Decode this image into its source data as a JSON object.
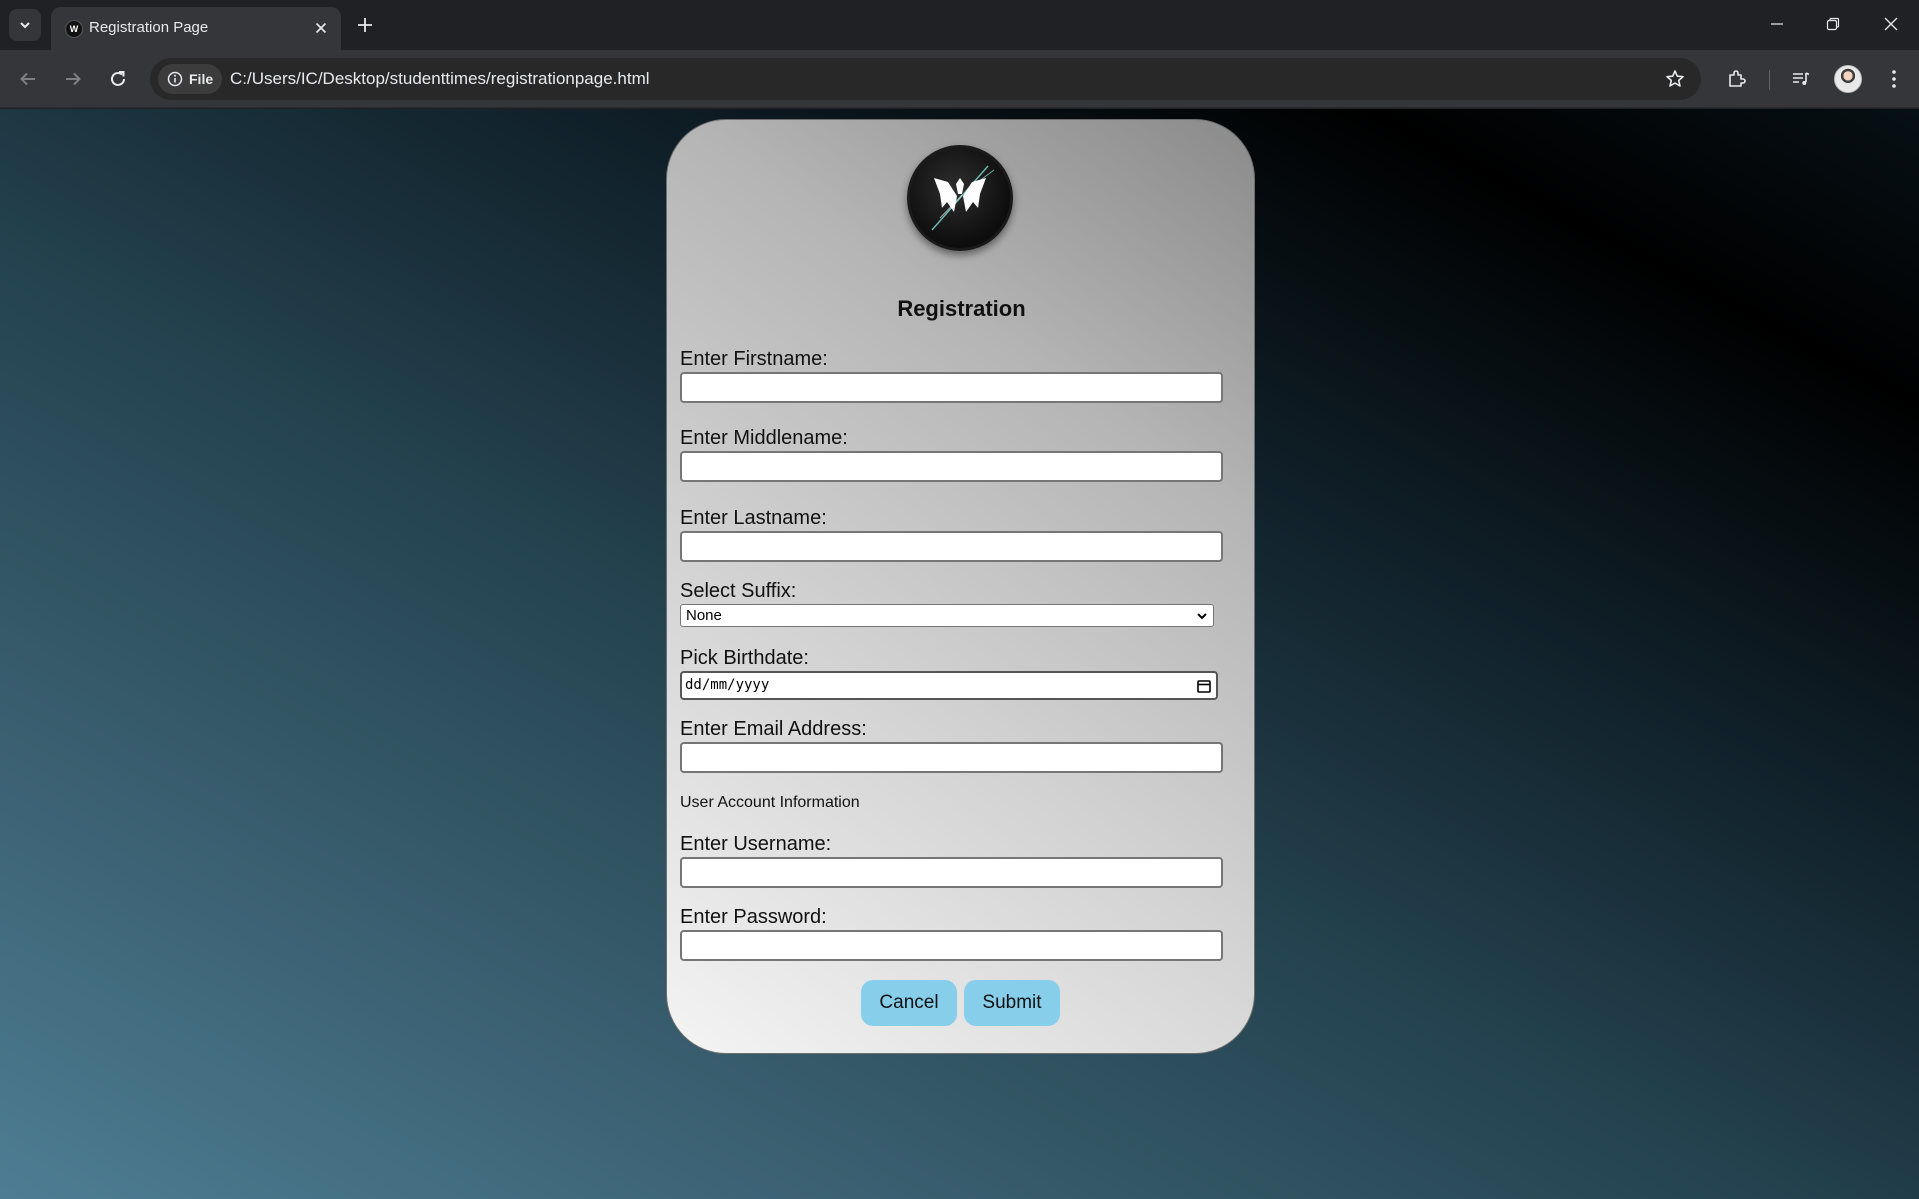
{
  "browser": {
    "tab_title": "Registration Page",
    "site_chip_label": "File",
    "url": "C:/Users/IC/Desktop/studenttimes/registrationpage.html",
    "favicon_letter": "W"
  },
  "form": {
    "title": "Registration",
    "fields": {
      "firstname_label": "Enter Firstname:",
      "middlename_label": "Enter Middlename:",
      "lastname_label": "Enter Lastname:",
      "suffix_label": "Select Suffix:",
      "suffix_value": "None",
      "birthdate_label": "Pick Birthdate:",
      "birthdate_placeholder": "dd/mm/yyyy",
      "email_label": "Enter Email Address:",
      "account_section": "User Account Information",
      "username_label": "Enter Username:",
      "password_label": "Enter Password:"
    },
    "buttons": {
      "cancel": "Cancel",
      "submit": "Submit"
    }
  },
  "colors": {
    "button_bg": "#87ceeb",
    "chrome_dark": "#202124",
    "chrome_toolbar": "#35363a"
  },
  "icons": [
    "chevron-down-icon",
    "close-icon",
    "plus-icon",
    "minimize-icon",
    "restore-icon",
    "back-arrow-icon",
    "forward-arrow-icon",
    "reload-icon",
    "info-icon",
    "star-icon",
    "extensions-icon",
    "media-queue-icon",
    "kebab-menu-icon",
    "calendar-icon",
    "logo-icon"
  ]
}
